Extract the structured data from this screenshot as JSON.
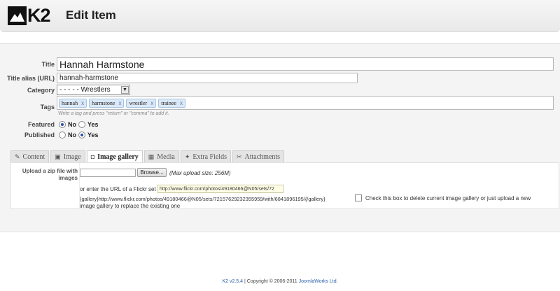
{
  "app": {
    "logo_text": "K2",
    "page_title": "Edit Item"
  },
  "form": {
    "title_label": "Title",
    "title_value": "Hannah Harmstone",
    "alias_label": "Title alias (URL)",
    "alias_value": "hannah-harmstone",
    "category_label": "Category",
    "category_value": "- - - - - Wrestlers",
    "tags_label": "Tags",
    "tags": [
      "hannah",
      "harmstone",
      "wrestler",
      "trainee"
    ],
    "tag_remove": "x",
    "tags_hint": "Write a tag and press \"return\" or \"comma\" to add it.",
    "featured_label": "Featured",
    "published_label": "Published",
    "no_label": "No",
    "yes_label": "Yes",
    "featured_value": "No",
    "published_value": "Yes"
  },
  "tabs": [
    {
      "label": "Content",
      "icon": "pencil-icon"
    },
    {
      "label": "Image",
      "icon": "image-icon"
    },
    {
      "label": "Image gallery",
      "icon": "camera-icon",
      "active": true
    },
    {
      "label": "Media",
      "icon": "film-icon"
    },
    {
      "label": "Extra Fields",
      "icon": "wrench-icon"
    },
    {
      "label": "Attachments",
      "icon": "paperclip-icon"
    }
  ],
  "gallery": {
    "upload_label": "Upload a zip file with images",
    "browse_label": "Browse...",
    "max_size": "(Max upload size: 256M)",
    "flickr_prompt": "or enter the URL of a Flickr set",
    "flickr_value": "http://www.flickr.com/photos/49180466@N05/sets/72",
    "gallery_tag": "{gallery}http://www.flickr.com/photos/49180466@N05/sets/72157629232355959/with/6841896195/{/gallery}",
    "delete_line1": "Check this box to delete current image gallery or just upload a new",
    "delete_line2": "image gallery to replace the existing one"
  },
  "footer": {
    "version": "K2 v2.5.4",
    "copyright": " | Copyright © 2006-2011 ",
    "company": "JoomlaWorks Ltd."
  }
}
